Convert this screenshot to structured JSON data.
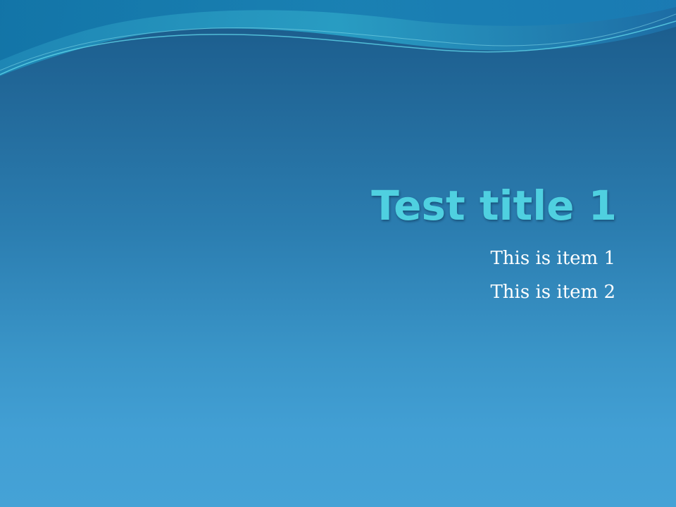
{
  "slide": {
    "title": "Test title 1",
    "items": [
      "This is item 1",
      "This is item 2"
    ]
  },
  "colors": {
    "title": "#4fd0e0",
    "item_text": "#ffffff",
    "background_top": "#1a5a8a",
    "background_bottom": "#45a2d6"
  }
}
